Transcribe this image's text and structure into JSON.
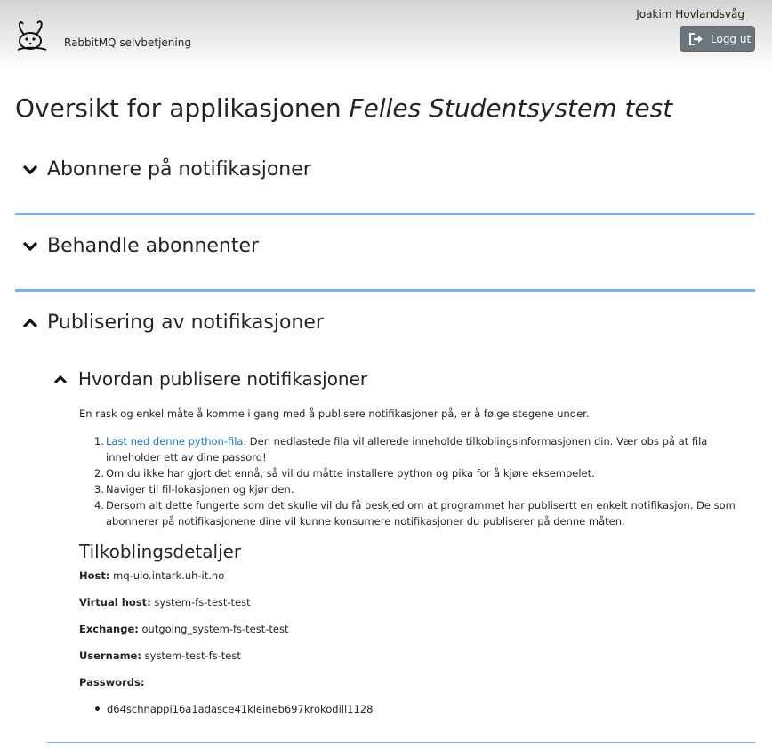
{
  "header": {
    "brand": "RabbitMQ selvbetjening",
    "user_name": "Joakim Hovlandsvåg",
    "logout_label": "Logg ut"
  },
  "page": {
    "title_prefix": "Oversikt for applikasjonen ",
    "title_app": "Felles Studentsystem test"
  },
  "sections": [
    {
      "label": "Abonnere på notifikasjoner",
      "expanded": false
    },
    {
      "label": "Behandle abonnenter",
      "expanded": false
    },
    {
      "label": "Publisering av notifikasjoner",
      "expanded": true
    }
  ],
  "publish": {
    "sub_label": "Hvordan publisere notifikasjoner",
    "intro": "En rask og enkel måte å komme i gang med å publisere notifikasjoner på, er å følge stegene under.",
    "steps": [
      {
        "num": "1.",
        "link": "Last ned denne python-fila",
        "text": ". Den nedlastede fila vil allerede inneholde tilkoblingsinformasjonen din. Vær obs på at fila inneholder ett av dine passord!"
      },
      {
        "num": "2.",
        "text": "Om du ikke har gjort det ennå, så vil du måtte installere python og pika for å kjøre eksempelet."
      },
      {
        "num": "3.",
        "text": "Naviger til fil-lokasjonen og kjør den."
      },
      {
        "num": "4.",
        "text": "Dersom alt dette fungerte som det skulle vil du få beskjed om at programmet har publisertt en enkelt notifikasjon. De som abonnerer på notifikasjonene dine vil kunne konsumere notifikasjoner du publiserer på denne måten."
      }
    ]
  },
  "connection": {
    "title": "Tilkoblingsdetaljer",
    "host_label": "Host:",
    "host": "mq-uio.intark.uh-it.no",
    "vhost_label": "Virtual host:",
    "vhost": "system-fs-test-test",
    "exchange_label": "Exchange:",
    "exchange": "outgoing_system-fs-test-test",
    "username_label": "Username:",
    "username": "system-test-fs-test",
    "passwords_label": "Passwords:",
    "passwords": [
      "d64schnappi16a1adasce41kleineb697krokodill1128"
    ]
  },
  "colors": {
    "divider": "#7aaff0",
    "link": "#1a6fc4",
    "button": "#6c757d"
  },
  "icons": {
    "logo": "rabbit-logo-icon",
    "logout": "sign-out-icon",
    "collapsed": "chevron-down-icon",
    "expanded": "chevron-up-icon"
  }
}
